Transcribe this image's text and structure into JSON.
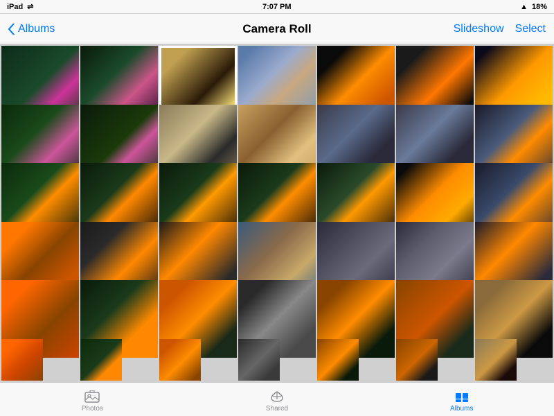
{
  "status": {
    "device": "iPad",
    "wifi": "WiFi",
    "time": "7:07 PM",
    "signal": "▲",
    "battery": "18%"
  },
  "nav": {
    "back_label": "Albums",
    "title": "Camera Roll",
    "slideshow_label": "Slideshow",
    "select_label": "Select"
  },
  "tabs": [
    {
      "id": "photos",
      "label": "Photos",
      "active": false
    },
    {
      "id": "shared",
      "label": "Shared",
      "active": false
    },
    {
      "id": "albums",
      "label": "Albums",
      "active": true
    }
  ],
  "photos": {
    "count": 42,
    "rows": 6,
    "cols": 7
  }
}
